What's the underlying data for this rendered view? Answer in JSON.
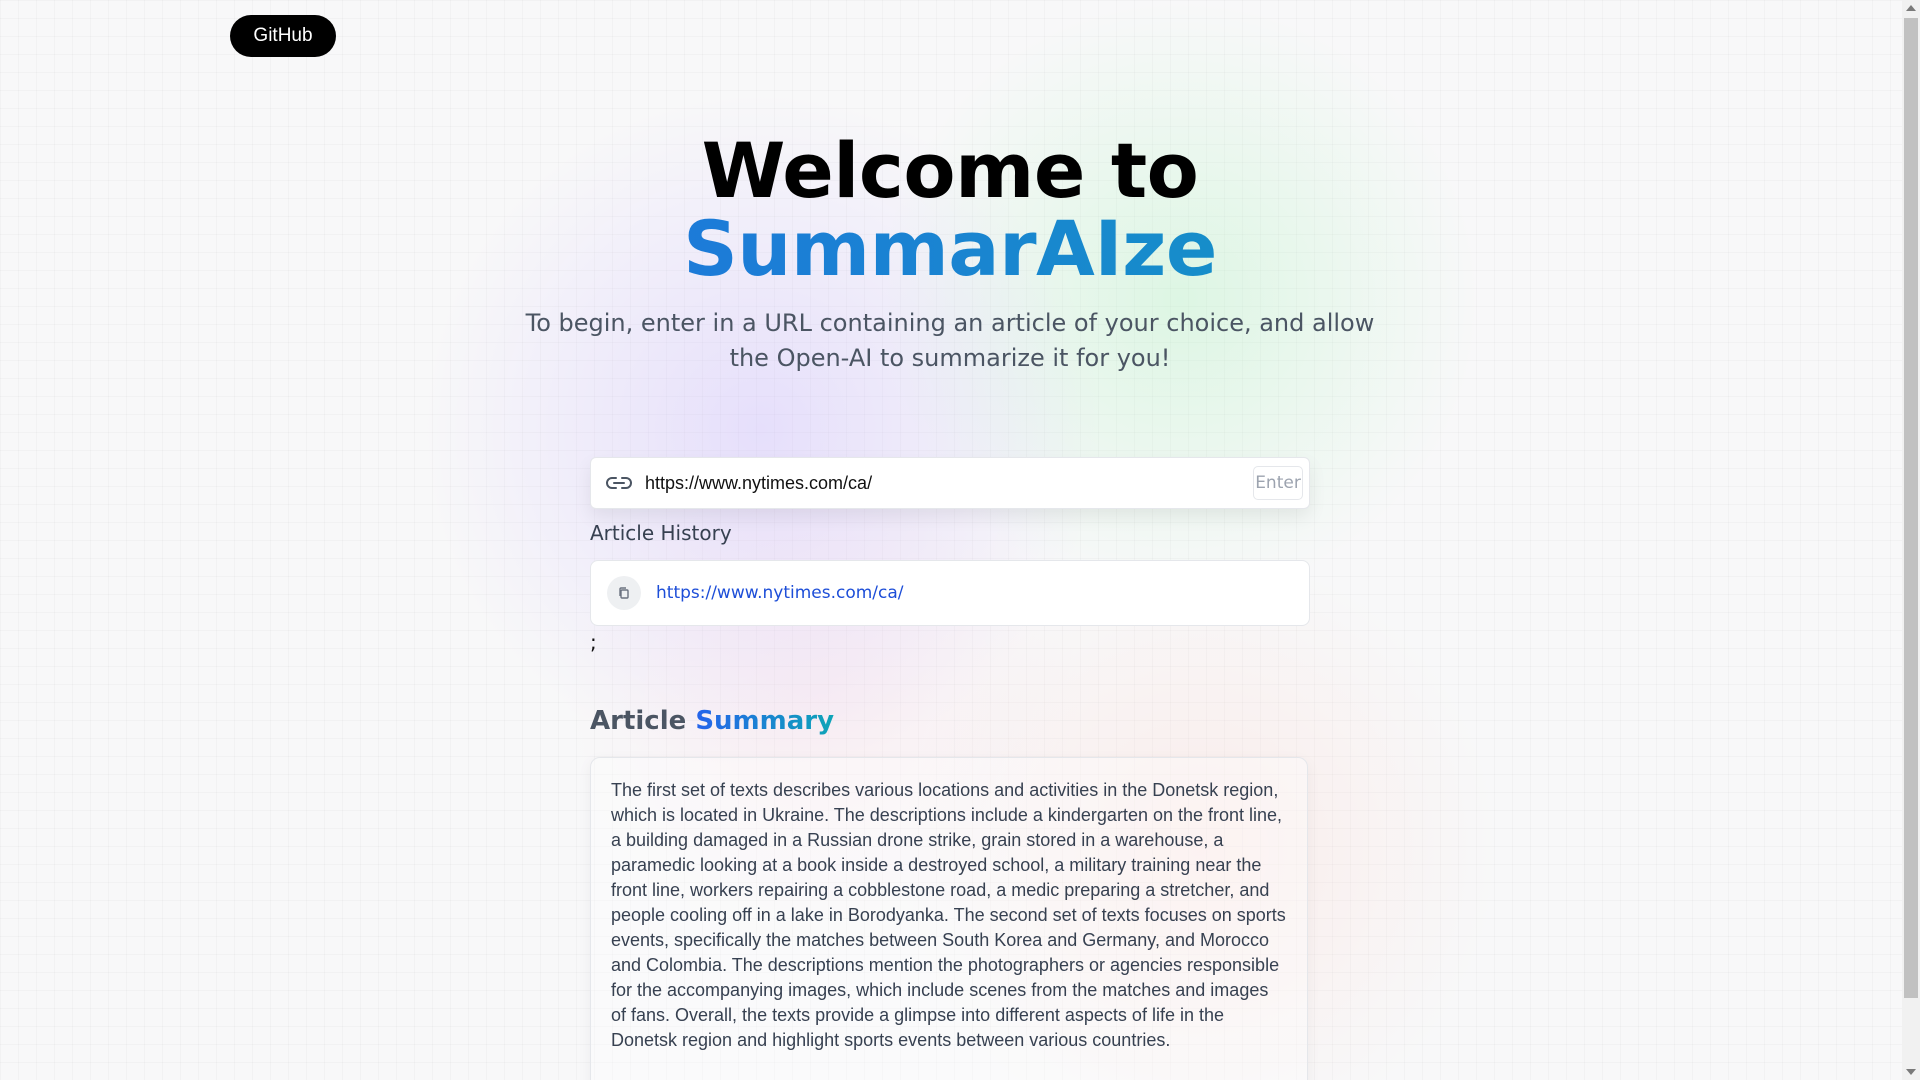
{
  "nav": {
    "github_label": "GitHub"
  },
  "hero": {
    "title_line1": "Welcome to",
    "title_line2": "SummarAIze",
    "subtitle": "To begin, enter in a URL containing an article of your choice, and allow the Open-AI to summarize it for you!"
  },
  "url_form": {
    "value": "https://www.nytimes.com/ca/",
    "enter_label": "Enter"
  },
  "history": {
    "label": "Article History",
    "items": [
      {
        "url": "https://www.nytimes.com/ca/"
      }
    ],
    "trailing_text": ";"
  },
  "summary": {
    "heading_plain": "Article",
    "heading_accent": "Summary",
    "text": "The first set of texts describes various locations and activities in the Donetsk region, which is located in Ukraine. The descriptions include a kindergarten on the front line, a building damaged in a Russian drone strike, grain stored in a warehouse, a paramedic looking at a book inside a destroyed school, a military training near the front line, workers repairing a cobblestone road, a medic preparing a stretcher, and people cooling off in a lake in Borodyanka. The second set of texts focuses on sports events, specifically the matches between South Korea and Germany, and Morocco and Colombia. The descriptions mention the photographers or agencies responsible for the accompanying images, which include scenes from the matches and images of fans. Overall, the texts provide a glimpse into different aspects of life in the Donetsk region and highlight sports events between various countries."
  },
  "icons": {
    "url_icon": "link-icon",
    "copy_icon": "copy-icon"
  },
  "colors": {
    "accent_start": "#2563eb",
    "accent_end": "#0ea5b7",
    "link": "#1d4ed8"
  }
}
